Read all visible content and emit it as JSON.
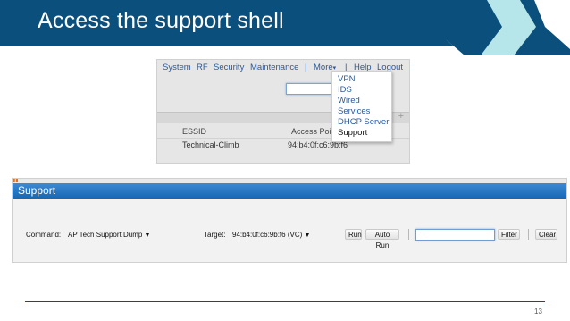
{
  "slide": {
    "title": "Access the support shell",
    "page_number": "13",
    "colors": {
      "header": "#0b4f7c",
      "accent": "#b7e6ea"
    }
  },
  "menu_screenshot": {
    "menubar": [
      "System",
      "RF",
      "Security",
      "Maintenance",
      "|",
      "More",
      "|",
      "Help",
      "Logout"
    ],
    "more_dropdown": [
      "VPN",
      "IDS",
      "Wired",
      "Services",
      "DHCP Server",
      "Support"
    ],
    "grid_header": {
      "essid": "ESSID",
      "access_point": "Access Poin"
    },
    "grid_row": {
      "essid": "Technical-Climb",
      "access_point": "94:b4:0f:c6:9b:f6"
    },
    "plus_icon": "plus-icon"
  },
  "support_panel": {
    "title": "Support",
    "command_label": "Command:",
    "command_value": "AP Tech Support Dump",
    "target_label": "Target:",
    "target_value": "94:b4:0f:c6:9b:f6 (VC)",
    "buttons": {
      "run": "Run",
      "auto_run": "Auto Run",
      "filter": "Filter",
      "clear": "Clear"
    },
    "filter_value": ""
  }
}
